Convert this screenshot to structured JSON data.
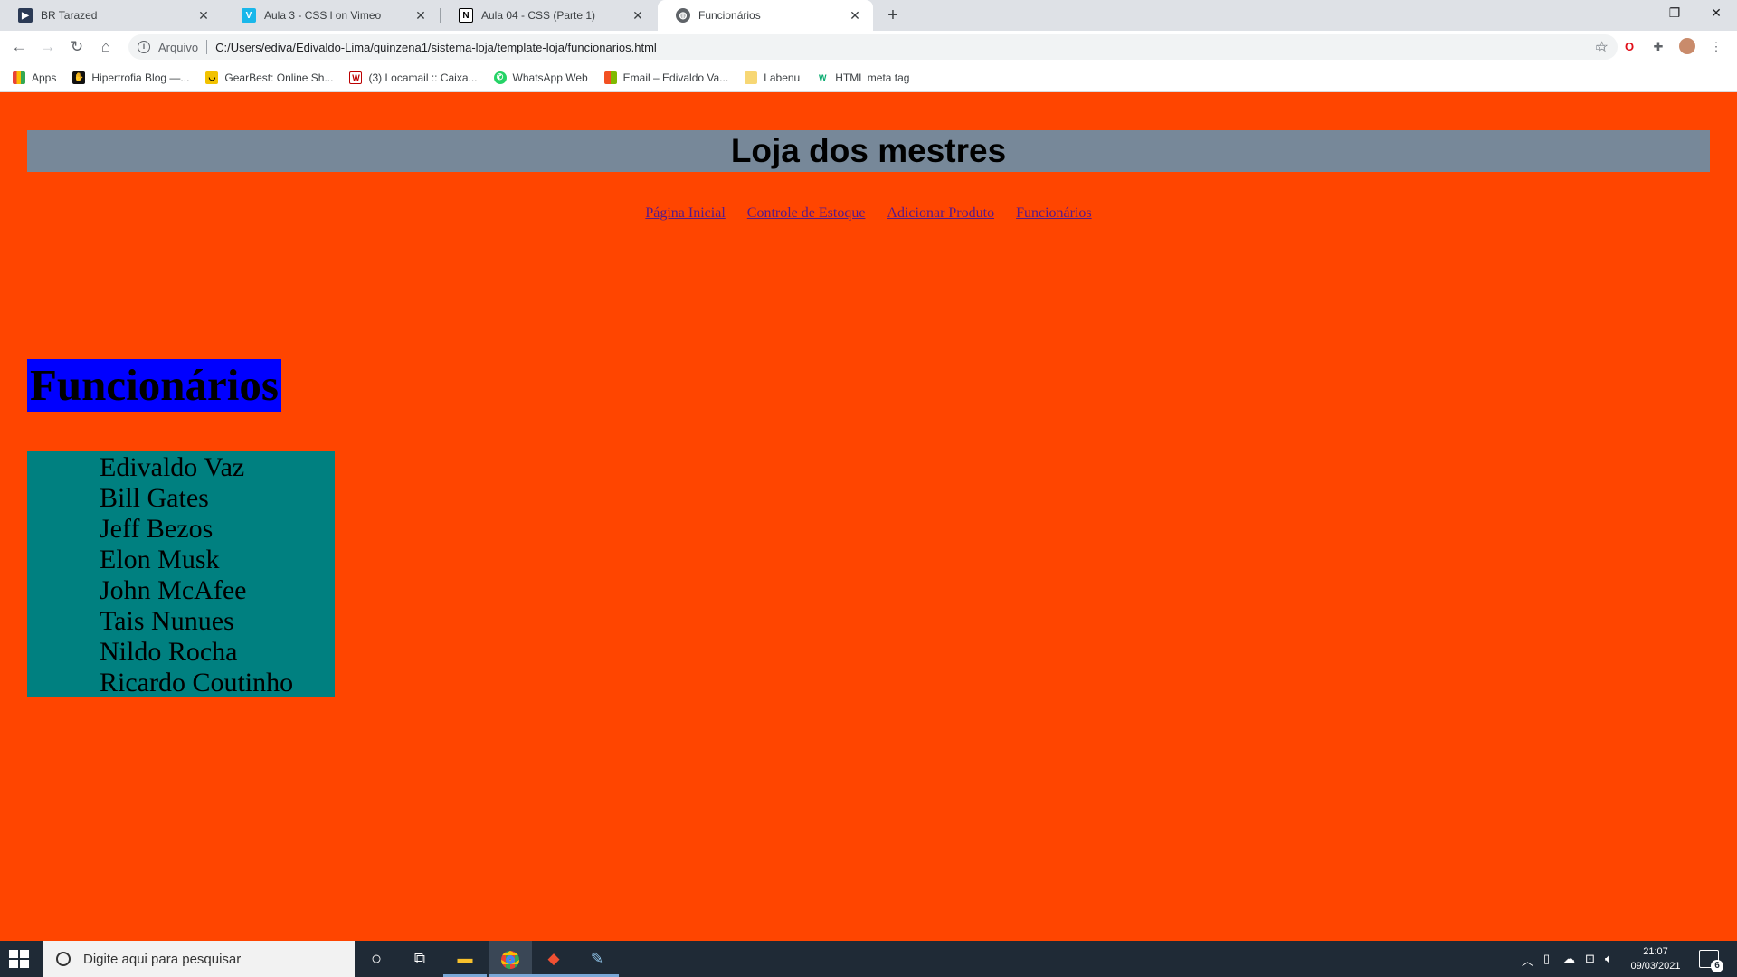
{
  "browser": {
    "tabs": [
      {
        "title": "BR Tarazed",
        "icon": "br-tarazed-favicon"
      },
      {
        "title": "Aula 3 - CSS l on Vimeo",
        "icon": "vimeo-favicon"
      },
      {
        "title": "Aula 04 - CSS (Parte 1)",
        "icon": "notion-favicon"
      },
      {
        "title": "Funcionários",
        "icon": "globe-favicon"
      }
    ],
    "omnibox": {
      "scheme_label": "Arquivo",
      "url": "C:/Users/ediva/Edivaldo-Lima/quinzena1/sistema-loja/template-loja/funcionarios.html"
    },
    "bookmarks": [
      {
        "label": "Apps",
        "icon": "apps-grid-icon"
      },
      {
        "label": "Hipertrofia Blog —...",
        "icon": "hipertrofia-icon"
      },
      {
        "label": "GearBest: Online Sh...",
        "icon": "gearbest-icon"
      },
      {
        "label": "(3) Locamail :: Caixa...",
        "icon": "locamail-icon"
      },
      {
        "label": "WhatsApp Web",
        "icon": "whatsapp-icon"
      },
      {
        "label": "Email – Edivaldo Va...",
        "icon": "microsoft-icon"
      },
      {
        "label": "Labenu",
        "icon": "folder-icon"
      },
      {
        "label": "HTML meta tag",
        "icon": "w3-icon"
      }
    ]
  },
  "site": {
    "title": "Loja dos mestres",
    "nav": [
      "Página Inicial",
      "Controle de Estoque",
      "Adicionar Produto",
      "Funcionários"
    ],
    "section_title": "Funcionários",
    "employees": [
      "Edivaldo Vaz",
      "Bill Gates",
      "Jeff Bezos",
      "Elon Musk",
      "John McAfee",
      "Tais Nunues",
      "Nildo Rocha",
      "Ricardo Coutinho"
    ]
  },
  "taskbar": {
    "search_placeholder": "Digite aqui para pesquisar",
    "time": "21:07",
    "date": "09/03/2021",
    "notification_count": "6"
  },
  "colors": {
    "page_background": "#ff4500",
    "header_background": "#778899",
    "section_title_background": "#0000ff",
    "list_background": "#008080"
  }
}
